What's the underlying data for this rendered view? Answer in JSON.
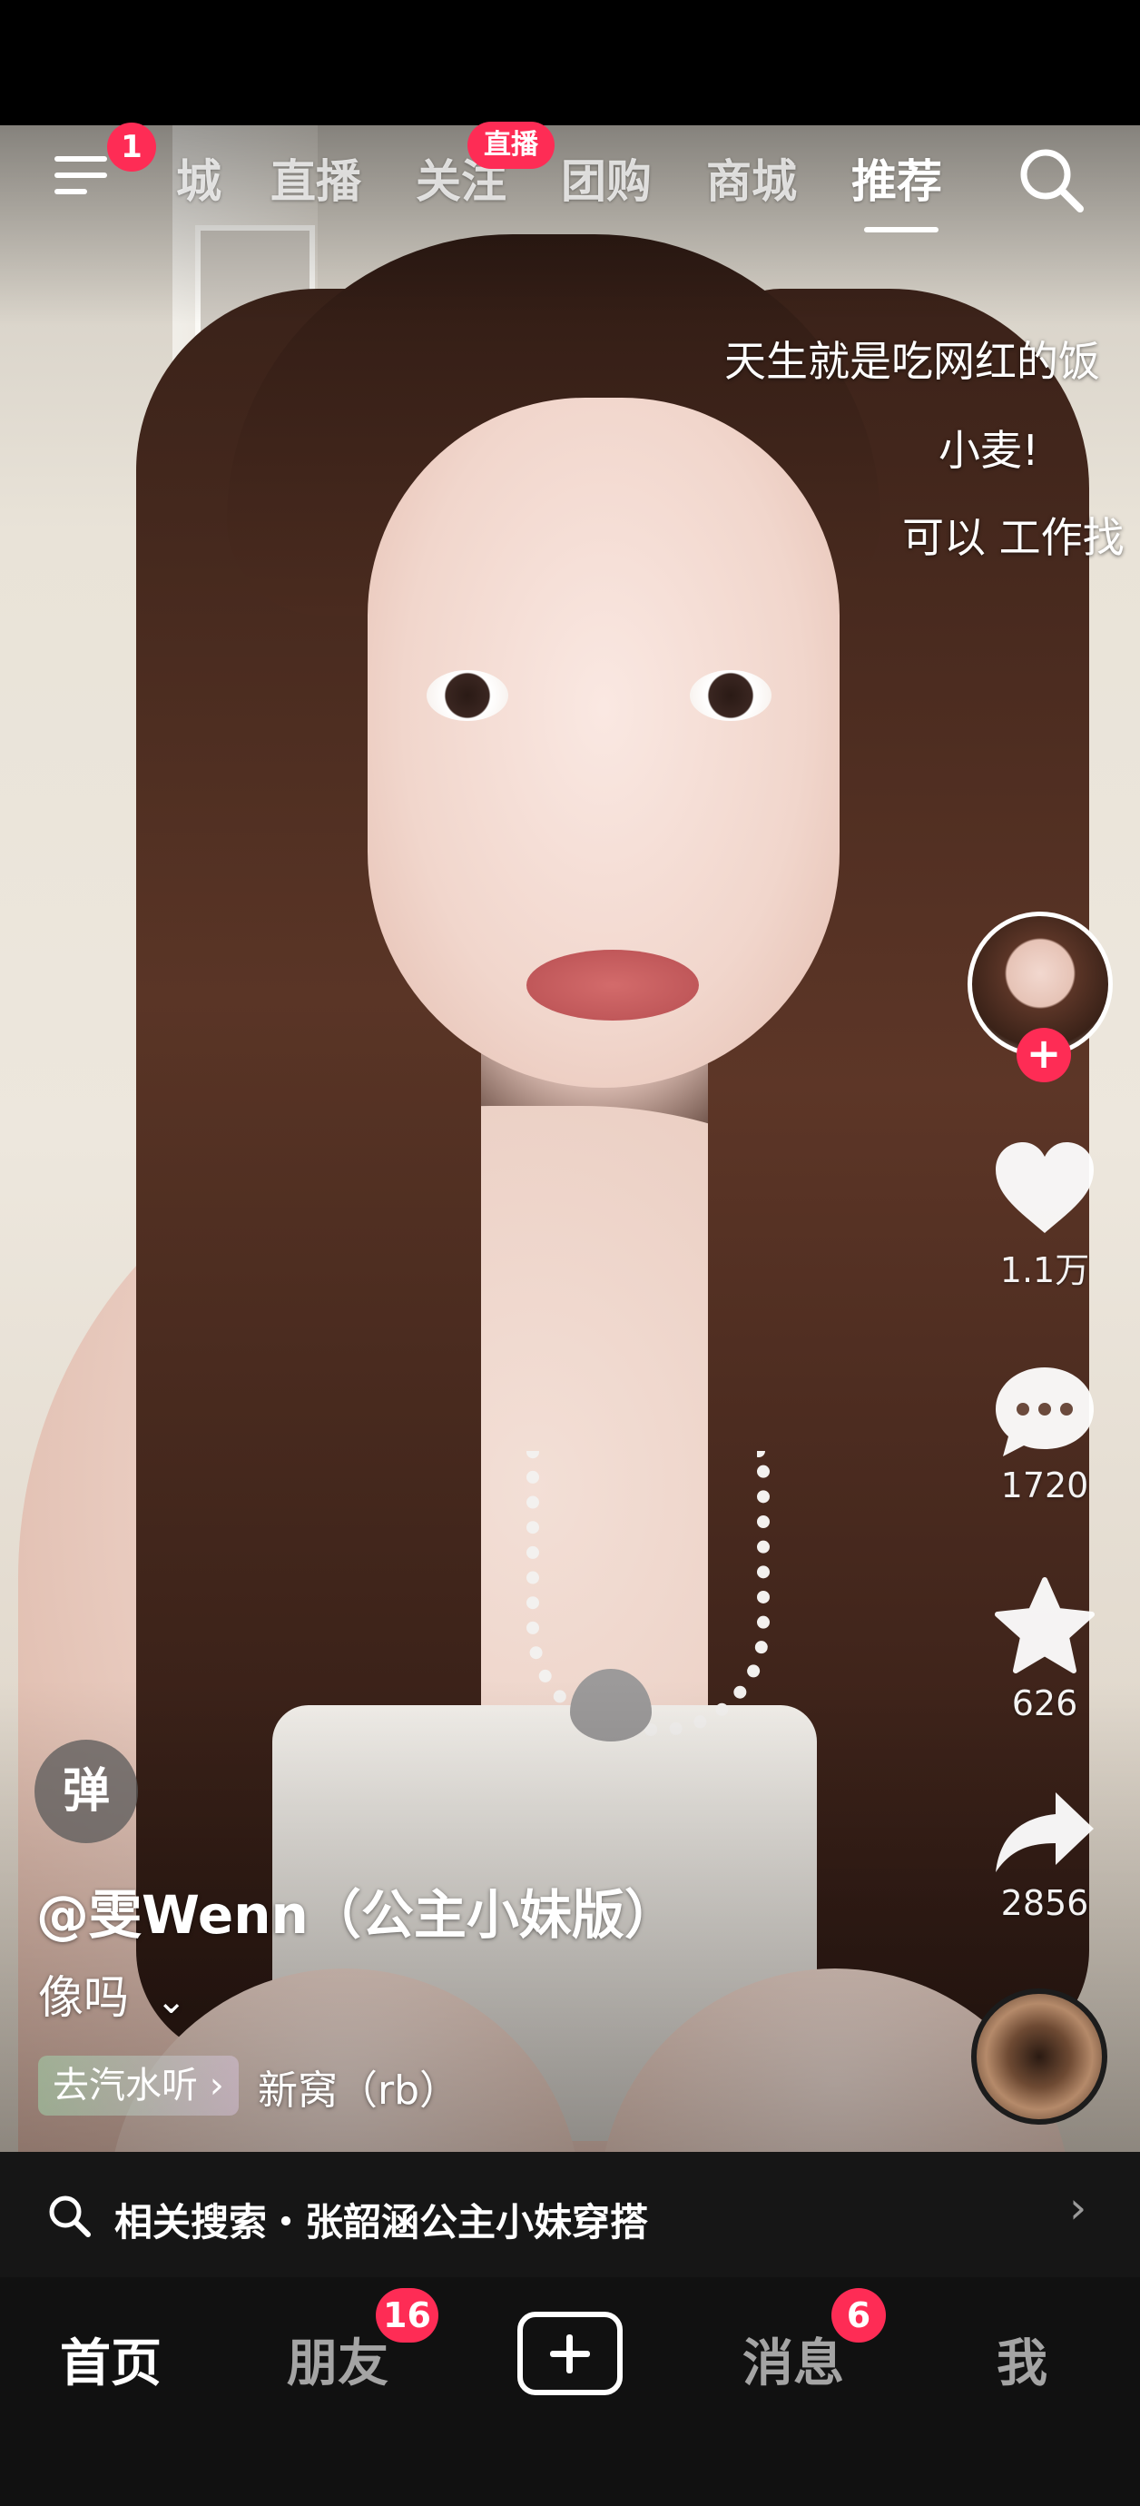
{
  "top_nav": {
    "menu_badge": "1",
    "tabs": [
      "城",
      "直播",
      "关注",
      "团购",
      "商城",
      "推荐"
    ],
    "active_tab": "推荐",
    "follow_live_badge": "直播"
  },
  "caption_lines": [
    "天生就是吃网红的饭",
    "小麦!",
    "可以 工作找"
  ],
  "actions": {
    "likes": "1.1万",
    "comments": "1720",
    "favorites": "626",
    "shares": "2856"
  },
  "video_info": {
    "danmu_label": "弹",
    "author": "@雯Wenn（公主小妹版）",
    "description": "像吗",
    "music_chip": "去汽水听",
    "music_chip_chevron": "›",
    "music_title": "新窝（rb）"
  },
  "related_search": {
    "text": "相关搜索・张韶涵公主小妹穿搭",
    "chevron": "›"
  },
  "bottom_tabs": {
    "home": "首页",
    "friends": "朋友",
    "friends_badge": "16",
    "messages": "消息",
    "messages_badge": "6",
    "me": "我"
  },
  "colors": {
    "accent": "#fe2c55",
    "tabbar_bg": "#111111",
    "related_bg": "#161616"
  },
  "icons": [
    "menu-icon",
    "search-icon",
    "plus-icon",
    "heart-icon",
    "comment-icon",
    "star-icon",
    "share-icon",
    "music-disc-icon",
    "chevron-down-icon",
    "chevron-right-icon",
    "create-plus-icon"
  ]
}
